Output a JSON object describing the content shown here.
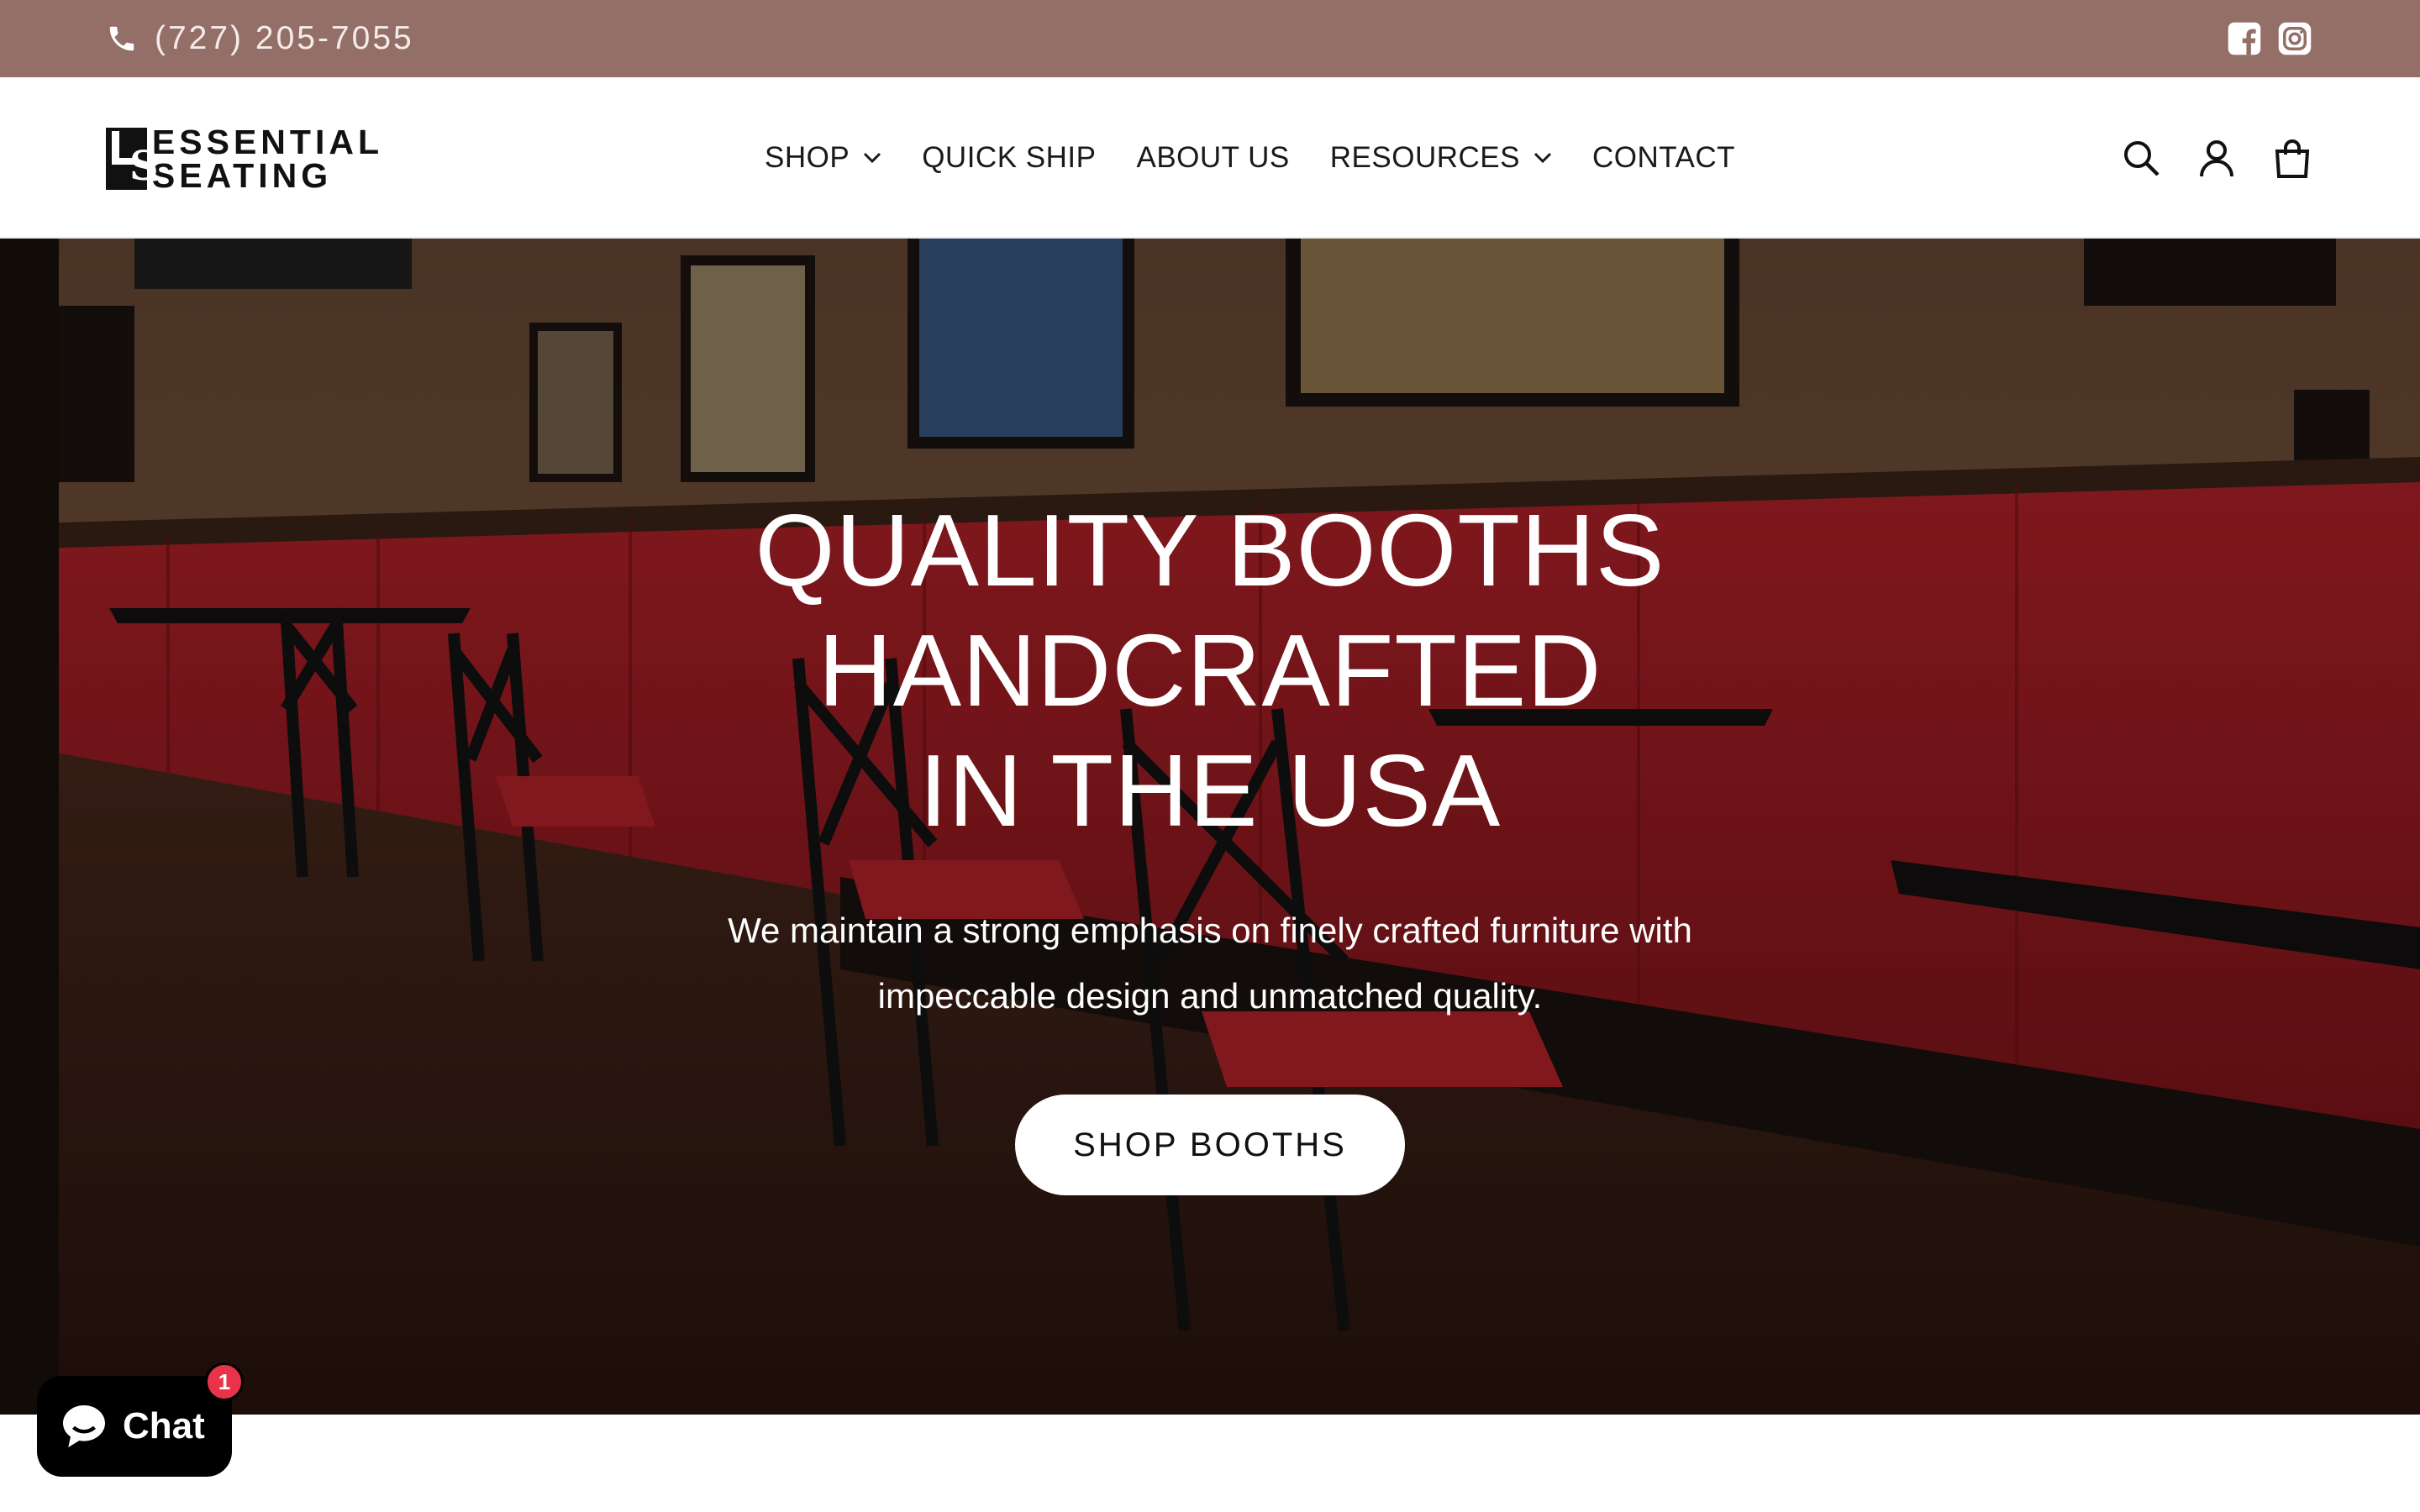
{
  "topbar": {
    "phone_icon": "phone-icon",
    "phone": "(727) 205-7055",
    "socials": [
      {
        "name": "facebook-icon"
      },
      {
        "name": "instagram-icon"
      }
    ],
    "background": "#936f67"
  },
  "header": {
    "logo": {
      "line1": "ESSENTIAL",
      "line2": "SEATING",
      "monogram": "S"
    },
    "nav": [
      {
        "label": "SHOP",
        "has_dropdown": true
      },
      {
        "label": "QUICK SHIP",
        "has_dropdown": false
      },
      {
        "label": "ABOUT US",
        "has_dropdown": false
      },
      {
        "label": "RESOURCES",
        "has_dropdown": true
      },
      {
        "label": "CONTACT",
        "has_dropdown": false
      }
    ],
    "icons": [
      "search-icon",
      "account-icon",
      "cart-icon"
    ]
  },
  "hero": {
    "title_lines": [
      "QUALITY BOOTHS",
      "HANDCRAFTED",
      "IN THE USA"
    ],
    "subtitle": "We maintain a strong emphasis on finely crafted furniture with impeccable design and unmatched quality.",
    "cta": "SHOP BOOTHS"
  },
  "chat": {
    "label": "Chat",
    "badge": "1",
    "badge_color": "#e8334a"
  }
}
